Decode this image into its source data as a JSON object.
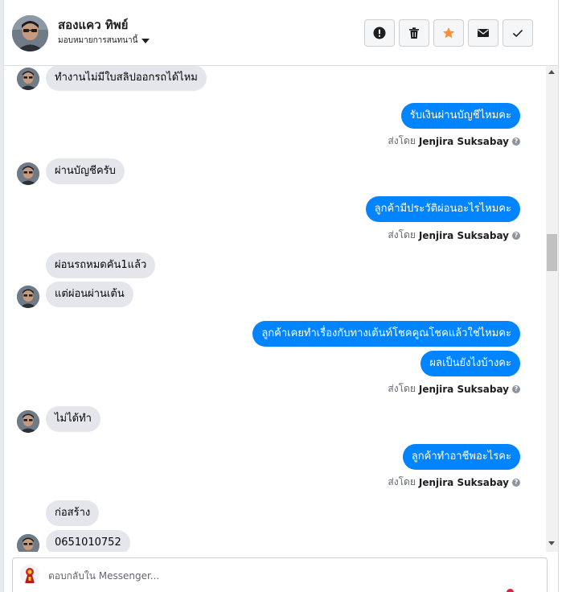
{
  "header": {
    "contact_name": "สองแคว ทิพย์",
    "assignment_label": "มอบหมายการสนทนานี้"
  },
  "actions": [
    {
      "name": "report-button",
      "icon": "exclamation-icon"
    },
    {
      "name": "delete-button",
      "icon": "trash-icon"
    },
    {
      "name": "star-button",
      "icon": "star-icon",
      "color": "#f7923b"
    },
    {
      "name": "mark-unread-button",
      "icon": "envelope-icon"
    },
    {
      "name": "mark-done-button",
      "icon": "checkmark-icon"
    }
  ],
  "thread": {
    "messages": [
      {
        "dir": "in",
        "text": "ทำงานไม่มีใบสลิปออกรถได้ไหม"
      },
      {
        "dir": "out",
        "text": "รับเงินผ่านบัญชีไหมคะ"
      },
      {
        "dir": "in",
        "text": "ผ่านบัญชีครับ"
      },
      {
        "dir": "out",
        "text": "ลูกค้ามีประวัติผ่อนอะไรไหมคะ"
      },
      {
        "dir": "in",
        "text": "ผ่อนรถหมดคัน1แล้ว"
      },
      {
        "dir": "in",
        "text": "แต่ผ่อนผ่านเต้น"
      },
      {
        "dir": "out",
        "text": "ลูกค้าเคยทำเรื่องกับทางเต้นท์โชคคูณโชคแล้วใช่ไหมคะ"
      },
      {
        "dir": "out",
        "text": "ผลเป็นยังไงบ้างคะ"
      },
      {
        "dir": "in",
        "text": "ไม่ได้ทำ"
      },
      {
        "dir": "out",
        "text": "ลูกค้าทำอาชีพอะไรคะ"
      },
      {
        "dir": "in",
        "text": "ก่อสร้าง"
      },
      {
        "dir": "in",
        "text": "0651010752"
      }
    ],
    "sent_by_prefix": "ส่งโดย",
    "sent_by_name": "Jenjira Suksabay"
  },
  "composer": {
    "placeholder": "ตอบกลับใน Messenger..."
  },
  "colors": {
    "outgoing_bubble": "#0084ff",
    "incoming_bubble": "#e4e6eb",
    "star": "#f7923b"
  }
}
